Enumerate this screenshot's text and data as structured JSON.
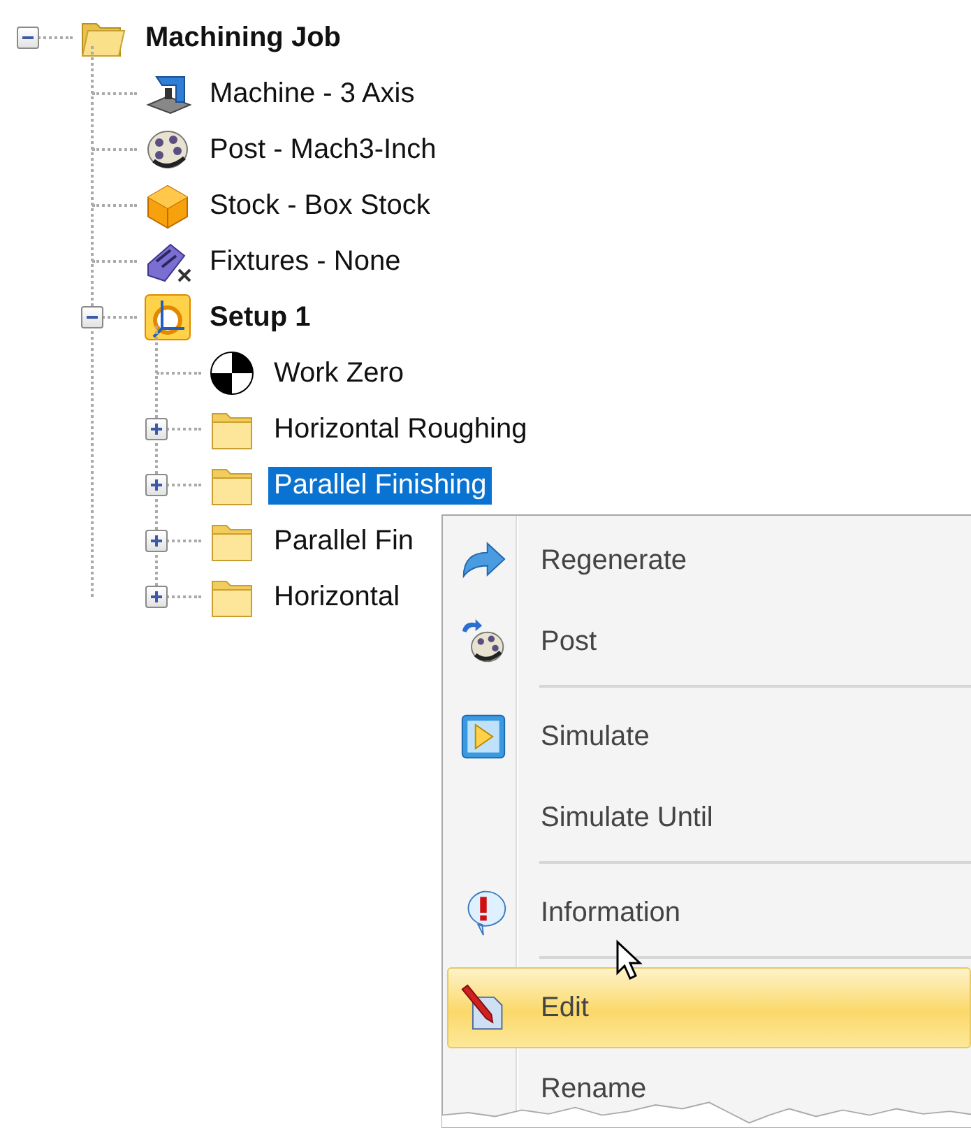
{
  "tree": [
    {
      "label": "Machining Job",
      "kind": "job",
      "expanded": true,
      "selected": false,
      "children": [
        {
          "label": "Machine - 3 Axis",
          "kind": "machine",
          "selected": false
        },
        {
          "label": "Post - Mach3-Inch",
          "kind": "post",
          "selected": false
        },
        {
          "label": "Stock - Box Stock",
          "kind": "stock",
          "selected": false
        },
        {
          "label": "Fixtures - None",
          "kind": "fixtures",
          "selected": false
        },
        {
          "label": "Setup 1",
          "kind": "setup",
          "expanded": true,
          "selected": false,
          "children": [
            {
              "label": "Work Zero",
              "kind": "work-zero",
              "selected": false
            },
            {
              "label": "Horizontal Roughing",
              "kind": "folder",
              "expanded": false,
              "selected": false
            },
            {
              "label": "Parallel Finishing",
              "kind": "folder",
              "expanded": false,
              "selected": true
            },
            {
              "label": "Parallel Fin",
              "kind": "folder",
              "expanded": false,
              "selected": false
            },
            {
              "label": "Horizontal",
              "kind": "folder",
              "expanded": false,
              "selected": false
            }
          ]
        }
      ]
    }
  ],
  "context_menu": [
    {
      "kind": "regenerate",
      "label": "Regenerate",
      "selected": false
    },
    {
      "kind": "post",
      "label": "Post",
      "selected": false
    },
    {
      "kind": "separator"
    },
    {
      "kind": "simulate",
      "label": "Simulate",
      "selected": false
    },
    {
      "kind": "none",
      "label": "Simulate Until",
      "selected": false
    },
    {
      "kind": "separator"
    },
    {
      "kind": "information",
      "label": "Information",
      "selected": false
    },
    {
      "kind": "separator"
    },
    {
      "kind": "edit",
      "label": "Edit",
      "selected": true
    },
    {
      "kind": "none",
      "label": "Rename",
      "selected": false
    }
  ]
}
